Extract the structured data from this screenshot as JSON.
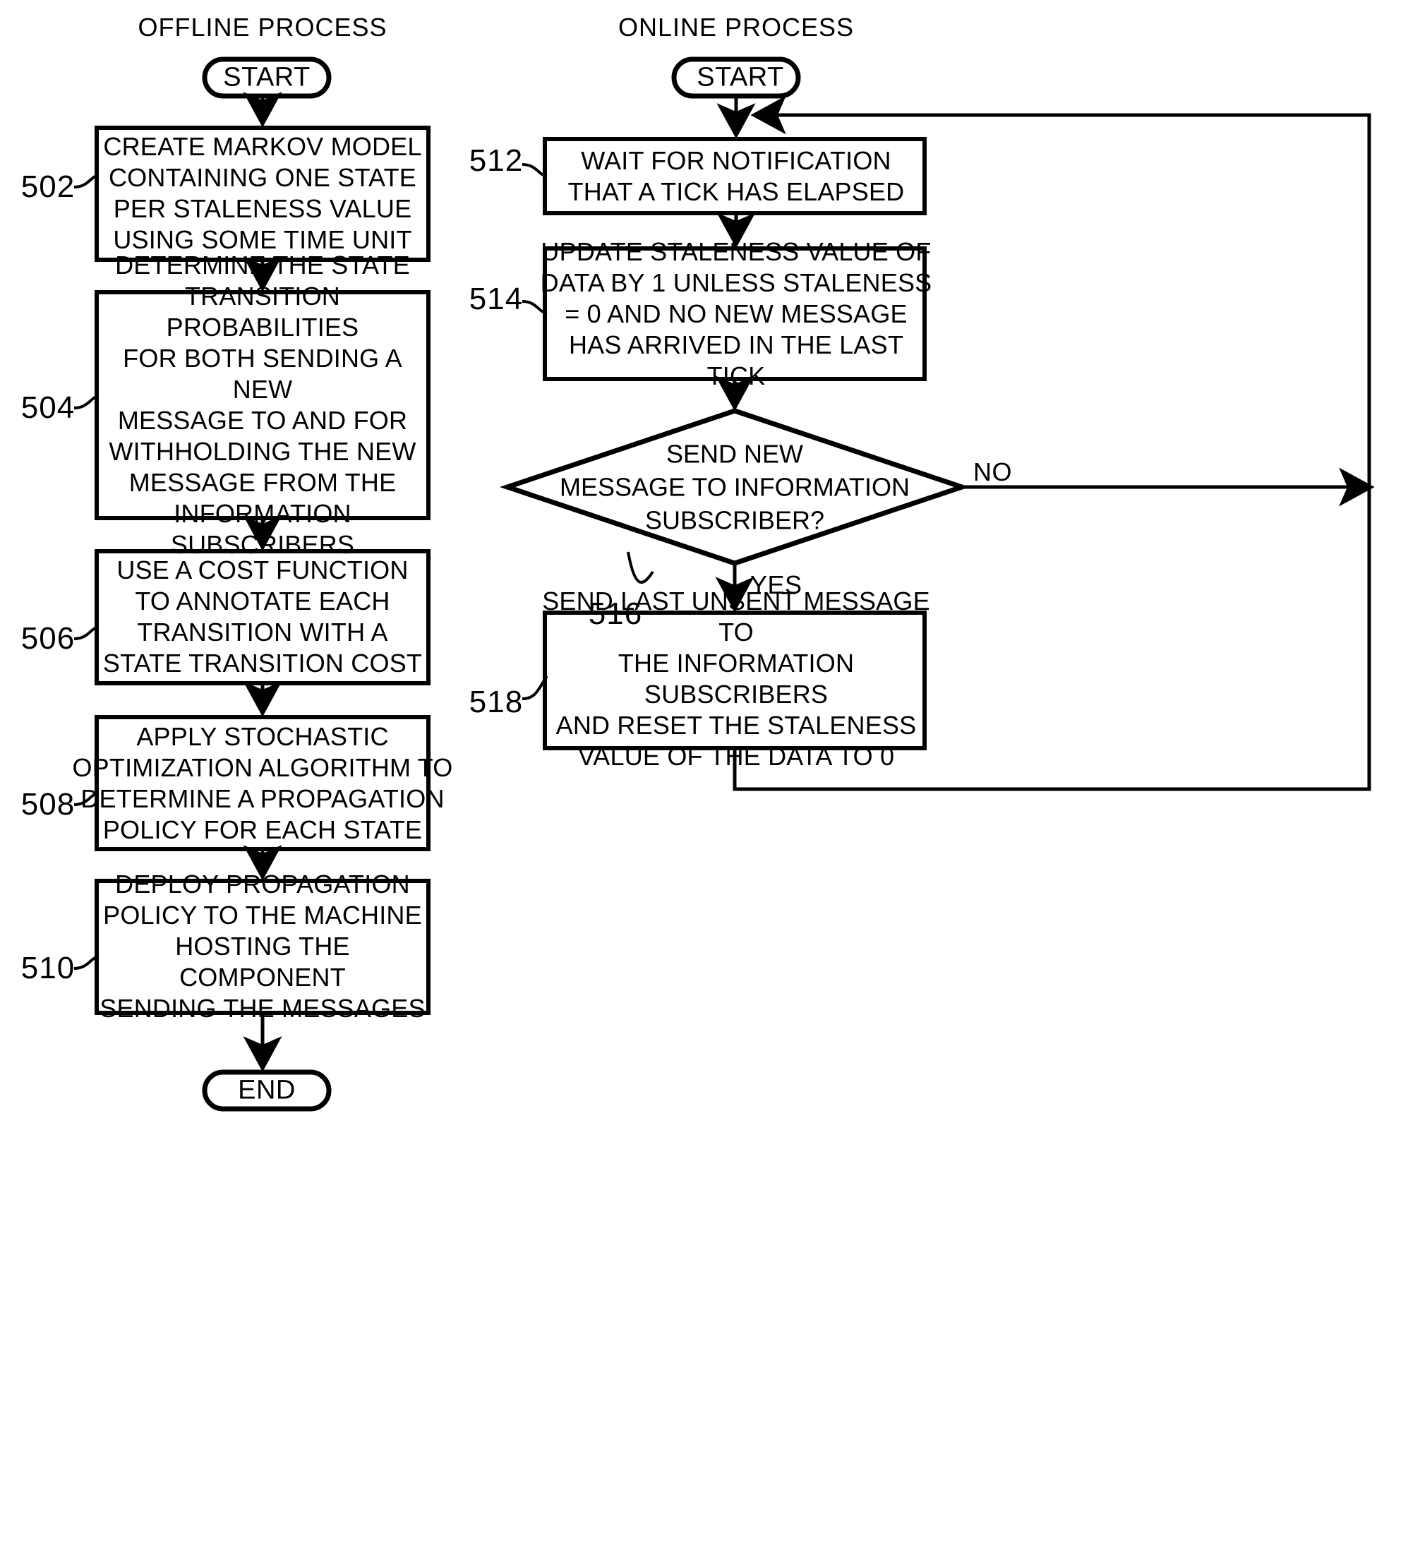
{
  "figure": {
    "type": "flowchart",
    "columns": [
      {
        "title": "OFFLINE PROCESS",
        "nodes": [
          {
            "ref": "",
            "shape": "terminator",
            "label": "START"
          },
          {
            "ref": "502",
            "shape": "process",
            "lines": [
              "CREATE MARKOV MODEL",
              "CONTAINING ONE STATE",
              "PER STALENESS VALUE",
              "USING SOME TIME UNIT"
            ]
          },
          {
            "ref": "504",
            "shape": "process",
            "lines": [
              "DETERMINE THE STATE",
              "TRANSITION PROBABILITIES",
              "FOR BOTH SENDING A NEW",
              "MESSAGE TO AND FOR",
              "WITHHOLDING THE NEW",
              "MESSAGE FROM THE",
              "INFORMATION SUBSCRIBERS"
            ]
          },
          {
            "ref": "506",
            "shape": "process",
            "lines": [
              "USE A COST FUNCTION",
              "TO ANNOTATE EACH",
              "TRANSITION WITH A",
              "STATE TRANSITION COST"
            ]
          },
          {
            "ref": "508",
            "shape": "process",
            "lines": [
              "APPLY STOCHASTIC",
              "OPTIMIZATION ALGORITHM TO",
              "DETERMINE A PROPAGATION",
              "POLICY FOR EACH STATE"
            ]
          },
          {
            "ref": "510",
            "shape": "process",
            "lines": [
              "DEPLOY PROPAGATION",
              "POLICY TO THE MACHINE",
              "HOSTING THE COMPONENT",
              "SENDING THE MESSAGES"
            ]
          },
          {
            "ref": "",
            "shape": "terminator",
            "label": "END"
          }
        ]
      },
      {
        "title": "ONLINE PROCESS",
        "nodes": [
          {
            "ref": "",
            "shape": "terminator",
            "label": "START"
          },
          {
            "ref": "512",
            "shape": "process",
            "lines": [
              "WAIT FOR NOTIFICATION",
              "THAT A TICK HAS ELAPSED"
            ]
          },
          {
            "ref": "514",
            "shape": "process",
            "lines": [
              "UPDATE STALENESS VALUE OF",
              "DATA BY 1 UNLESS STALENESS",
              "= 0 AND NO NEW MESSAGE",
              "HAS ARRIVED IN THE LAST TICK"
            ]
          },
          {
            "ref": "516",
            "shape": "decision",
            "lines": [
              "SEND NEW",
              "MESSAGE TO INFORMATION",
              "SUBSCRIBER?"
            ]
          },
          {
            "ref": "518",
            "shape": "process",
            "lines": [
              "SEND LAST UNSENT MESSAGE TO",
              "THE INFORMATION SUBSCRIBERS",
              "AND RESET THE STALENESS",
              "VALUE OF THE DATA TO 0"
            ]
          }
        ],
        "edge_labels": {
          "no": "NO",
          "yes": "YES"
        }
      }
    ],
    "colors": {
      "stroke": "#000000",
      "fill": "#ffffff",
      "background": "#ffffff"
    }
  },
  "left": {
    "title": "OFFLINE PROCESS",
    "start": "START",
    "end": "END",
    "ref502": "502",
    "ref504": "504",
    "ref506": "506",
    "ref508": "508",
    "ref510": "510",
    "b502_l1": "CREATE MARKOV MODEL",
    "b502_l2": "CONTAINING ONE STATE",
    "b502_l3": "PER STALENESS VALUE",
    "b502_l4": "USING SOME TIME UNIT",
    "b504_l1": "DETERMINE THE STATE",
    "b504_l2": "TRANSITION PROBABILITIES",
    "b504_l3": "FOR BOTH SENDING A NEW",
    "b504_l4": "MESSAGE TO AND FOR",
    "b504_l5": "WITHHOLDING THE NEW",
    "b504_l6": "MESSAGE FROM THE",
    "b504_l7": "INFORMATION SUBSCRIBERS",
    "b506_l1": "USE A COST FUNCTION",
    "b506_l2": "TO ANNOTATE EACH",
    "b506_l3": "TRANSITION WITH A",
    "b506_l4": "STATE TRANSITION COST",
    "b508_l1": "APPLY STOCHASTIC",
    "b508_l2": "OPTIMIZATION ALGORITHM TO",
    "b508_l3": "DETERMINE A PROPAGATION",
    "b508_l4": "POLICY FOR EACH STATE",
    "b510_l1": "DEPLOY PROPAGATION",
    "b510_l2": "POLICY TO THE MACHINE",
    "b510_l3": "HOSTING THE COMPONENT",
    "b510_l4": "SENDING THE MESSAGES"
  },
  "right": {
    "title": "ONLINE PROCESS",
    "start": "START",
    "ref512": "512",
    "ref514": "514",
    "ref516": "516",
    "ref518": "518",
    "label_no": "NO",
    "label_yes": "YES",
    "b512_l1": "WAIT FOR NOTIFICATION",
    "b512_l2": "THAT A TICK HAS ELAPSED",
    "b514_l1": "UPDATE STALENESS VALUE OF",
    "b514_l2": "DATA BY 1 UNLESS STALENESS",
    "b514_l3": "= 0 AND NO NEW MESSAGE",
    "b514_l4": "HAS ARRIVED IN THE LAST TICK",
    "d516_l1": "SEND NEW",
    "d516_l2": "MESSAGE TO INFORMATION",
    "d516_l3": "SUBSCRIBER?",
    "b518_l1": "SEND LAST UNSENT MESSAGE TO",
    "b518_l2": "THE INFORMATION SUBSCRIBERS",
    "b518_l3": "AND RESET THE STALENESS",
    "b518_l4": "VALUE OF THE DATA TO 0"
  }
}
